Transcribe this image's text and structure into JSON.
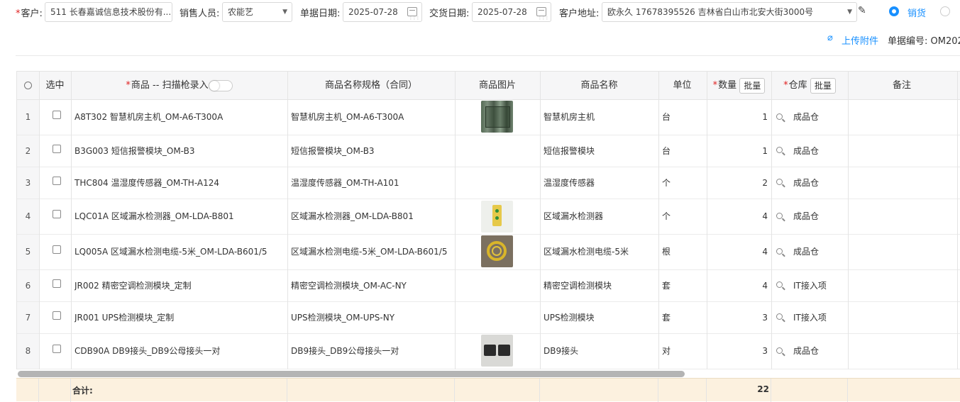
{
  "form": {
    "customer_label": "客户:",
    "customer_value": "511 长春嘉诚信息技术股份有...",
    "sales_label": "销售人员:",
    "sales_value": "农能艺",
    "doc_date_label": "单据日期:",
    "doc_date_value": "2025-07-28",
    "delivery_date_label": "交货日期:",
    "delivery_date_value": "2025-07-28",
    "address_label": "客户地址:",
    "address_value": "欧永久 17678395526 吉林省白山市北安大街3000号",
    "radio_sales_label": "销货",
    "upload_label": "上传附件",
    "doc_no_label": "单据编号:",
    "doc_no_value": "OM202"
  },
  "table": {
    "headers": {
      "select": "选中",
      "product": "商品 -- 扫描枪录入",
      "spec": "商品名称规格（合同）",
      "image": "商品图片",
      "name": "商品名称",
      "unit": "单位",
      "qty": "数量",
      "warehouse": "仓库",
      "remark": "备注",
      "batch": "批量"
    },
    "rows": [
      {
        "idx": "1",
        "product": "A8T302 智慧机房主机_OM-A6-T300A",
        "spec": "智慧机房主机_OM-A6-T300A",
        "name": "智慧机房主机",
        "unit": "台",
        "qty": "1",
        "warehouse": "成品仓"
      },
      {
        "idx": "2",
        "product": "B3G003 短信报警模块_OM-B3",
        "spec": "短信报警模块_OM-B3",
        "name": "短信报警模块",
        "unit": "台",
        "qty": "1",
        "warehouse": "成品仓"
      },
      {
        "idx": "3",
        "product": "THC804 温湿度传感器_OM-TH-A124",
        "spec": "温湿度传感器_OM-TH-A101",
        "name": "温湿度传感器",
        "unit": "个",
        "qty": "2",
        "warehouse": "成品仓"
      },
      {
        "idx": "4",
        "product": "LQC01A 区域漏水检测器_OM-LDA-B801",
        "spec": "区域漏水检测器_OM-LDA-B801",
        "name": "区域漏水检测器",
        "unit": "个",
        "qty": "4",
        "warehouse": "成品仓"
      },
      {
        "idx": "5",
        "product": "LQ005A 区域漏水检测电缆-5米_OM-LDA-B601/5",
        "spec": "区域漏水检测电缆-5米_OM-LDA-B601/5",
        "name": "区域漏水检测电缆-5米",
        "unit": "根",
        "qty": "4",
        "warehouse": "成品仓"
      },
      {
        "idx": "6",
        "product": "JR002 精密空调检测模块_定制",
        "spec": "精密空调检测模块_OM-AC-NY",
        "name": "精密空调检测模块",
        "unit": "套",
        "qty": "4",
        "warehouse": "IT接入项"
      },
      {
        "idx": "7",
        "product": "JR001 UPS检测模块_定制",
        "spec": "UPS检测模块_OM-UPS-NY",
        "name": "UPS检测模块",
        "unit": "套",
        "qty": "3",
        "warehouse": "IT接入项"
      },
      {
        "idx": "8",
        "product": "CDB90A DB9接头_DB9公母接头一对",
        "spec": "DB9接头_DB9公母接头一对",
        "name": "DB9接头",
        "unit": "对",
        "qty": "3",
        "warehouse": "成品仓"
      }
    ],
    "footer_label": "合计:",
    "footer_qty": "22"
  },
  "colors": {
    "accent": "#1890ff",
    "required": "#e02020",
    "footer_bg": "#fcf1df"
  }
}
